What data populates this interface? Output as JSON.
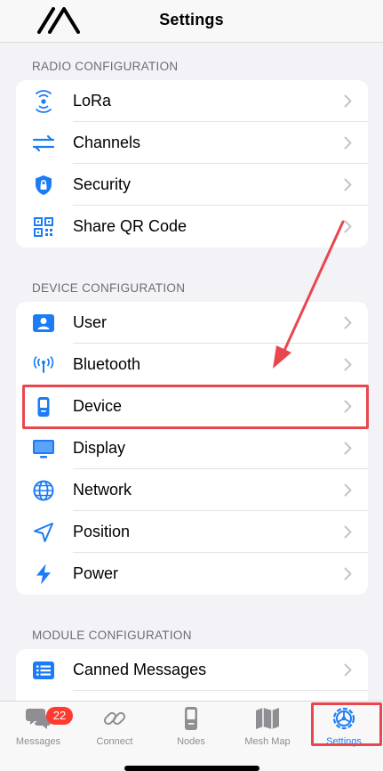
{
  "header": {
    "title": "Settings"
  },
  "sections": {
    "radio": {
      "title": "RADIO CONFIGURATION",
      "items": [
        {
          "label": "LoRa",
          "icon": "lora-signal-icon"
        },
        {
          "label": "Channels",
          "icon": "channels-arrows-icon"
        },
        {
          "label": "Security",
          "icon": "lock-shield-icon"
        },
        {
          "label": "Share QR Code",
          "icon": "qr-code-icon"
        }
      ]
    },
    "device": {
      "title": "DEVICE CONFIGURATION",
      "items": [
        {
          "label": "User",
          "icon": "user-card-icon"
        },
        {
          "label": "Bluetooth",
          "icon": "bluetooth-antenna-icon"
        },
        {
          "label": "Device",
          "icon": "handheld-device-icon"
        },
        {
          "label": "Display",
          "icon": "display-icon"
        },
        {
          "label": "Network",
          "icon": "globe-network-icon"
        },
        {
          "label": "Position",
          "icon": "location-arrow-icon"
        },
        {
          "label": "Power",
          "icon": "bolt-icon"
        }
      ]
    },
    "module": {
      "title": "MODULE CONFIGURATION",
      "items": [
        {
          "label": "Canned Messages",
          "icon": "list-icon"
        }
      ]
    }
  },
  "tabbar": {
    "tabs": [
      {
        "label": "Messages",
        "badge": "22",
        "icon": "chat-bubbles-icon"
      },
      {
        "label": "Connect",
        "icon": "link-icon"
      },
      {
        "label": "Nodes",
        "icon": "device-icon"
      },
      {
        "label": "Mesh Map",
        "icon": "map-icon"
      },
      {
        "label": "Settings",
        "icon": "gear-icon",
        "active": true
      }
    ]
  },
  "colors": {
    "accent": "#1b7cf6",
    "highlight": "#e8474f",
    "badge": "#ff3b30"
  }
}
